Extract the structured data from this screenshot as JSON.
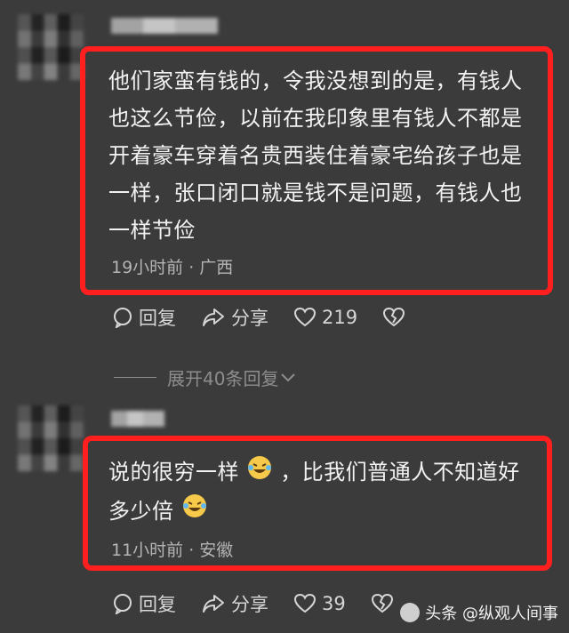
{
  "comments": [
    {
      "text_lines": [
        "他们家蛮有钱的，令我没想到的是，有钱人",
        "也这么节俭，以前在我印象里有钱人不都是",
        "开着豪车穿着名贵西装住着豪宅给孩子也是",
        "一样，张口闭口就是钱不是问题，有钱人也",
        "一样节俭"
      ],
      "meta": "19小时前 · 广西",
      "reply_label": "回复",
      "share_label": "分享",
      "like_count": "219"
    },
    {
      "line1_a": "说的很穷一样",
      "line1_b": "，比我们普通人不知道好",
      "line2": "多少倍",
      "emoji": "laughing-crying-emoji",
      "meta": "11小时前 · 安徽",
      "reply_label": "回复",
      "share_label": "分享",
      "like_count": "39"
    }
  ],
  "expand_replies": "展开40条回复",
  "watermark": "头条 @纵观人间事",
  "colors": {
    "highlight": "#ff1f1f",
    "background": "#3b3b3b"
  }
}
